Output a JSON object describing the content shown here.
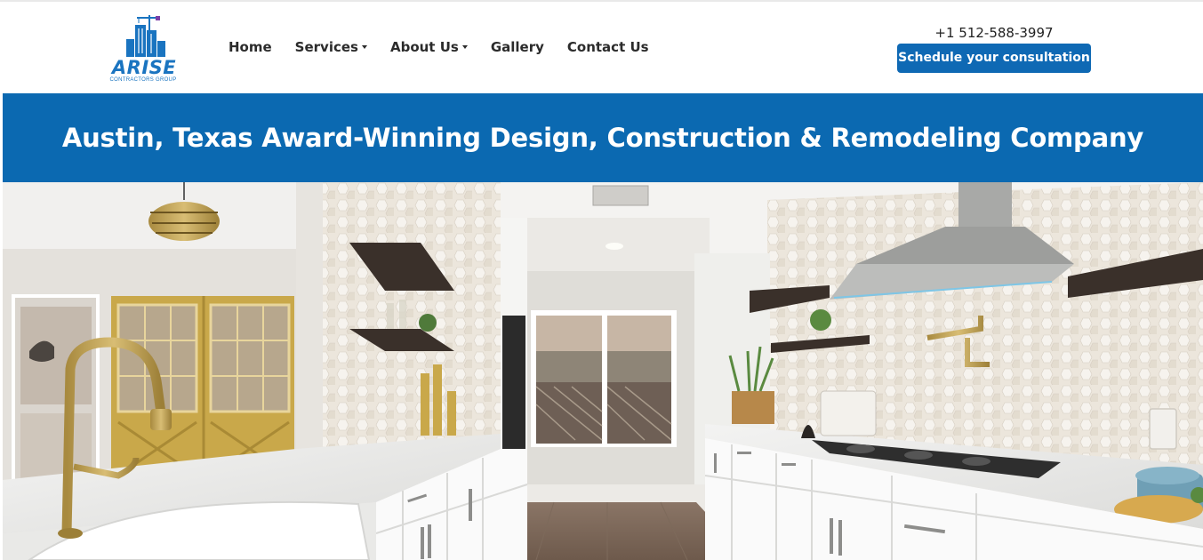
{
  "brand": {
    "name": "ARISE",
    "tagline": "CONTRACTORS GROUP",
    "logo_icon": "city-skyline-crane-icon",
    "primary_color": "#0b69b1"
  },
  "nav": {
    "items": [
      {
        "label": "Home",
        "has_dropdown": false
      },
      {
        "label": "Services",
        "has_dropdown": true
      },
      {
        "label": "About Us",
        "has_dropdown": true
      },
      {
        "label": "Gallery",
        "has_dropdown": false
      },
      {
        "label": "Contact Us",
        "has_dropdown": false
      }
    ]
  },
  "contact": {
    "phone": "+1 512-588-3997",
    "cta_label": "Schedule your consultation",
    "cta_color": "#0f69b4"
  },
  "hero": {
    "heading": "Austin, Texas Award-Winning Design, Construction & Remodeling Company",
    "image_subject": "white galley kitchen with marble countertops, gold faucet, floating shelves, hexagon tile backsplash and stainless range hood"
  }
}
